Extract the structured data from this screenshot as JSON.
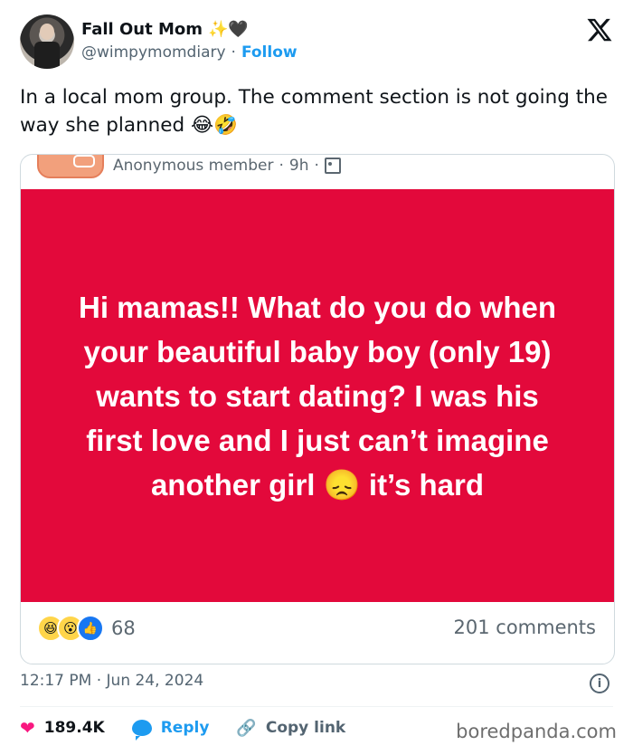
{
  "author": {
    "name": "Fall Out Mom",
    "name_emoji": "✨🖤",
    "handle": "@wimpymomdiary",
    "separator": "·",
    "follow_label": "Follow"
  },
  "tweet": {
    "text": "In a local mom group. The comment section is not going the way she planned 😂🤣"
  },
  "embedded_post": {
    "author": "Anonymous member",
    "time": "9h",
    "separator": "·",
    "body": "Hi mamas!! What do you do when your beautiful baby boy (only 19) wants to start dating? I was his first love and I just can’t imagine another girl 😞 it’s hard",
    "background_color": "#e3093b",
    "reaction_count": "68",
    "comments": "201 comments",
    "reactions": [
      "haha",
      "wow",
      "like"
    ]
  },
  "footer": {
    "timestamp": "12:17 PM · Jun 24, 2024",
    "like_count": "189.4K",
    "reply_label": "Reply",
    "copy_link_label": "Copy link",
    "info_icon": "i"
  },
  "watermark": "boredpanda.com",
  "icons": [
    "x-logo-icon",
    "info-icon",
    "heart-icon",
    "reply-icon",
    "link-icon"
  ]
}
